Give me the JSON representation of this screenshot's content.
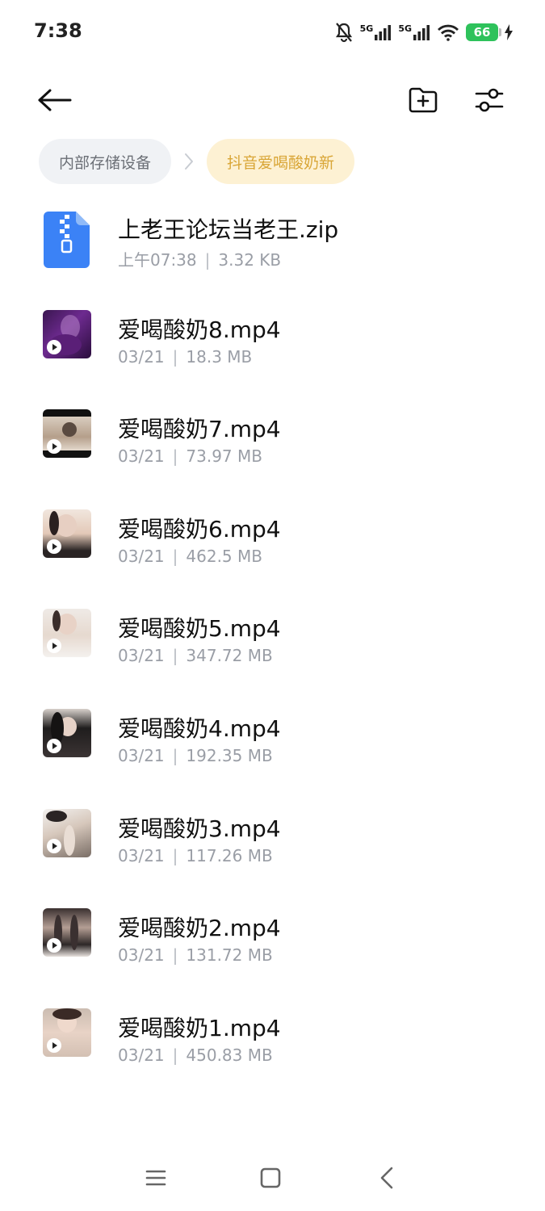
{
  "status_bar": {
    "time": "7:38",
    "network_1": "5G",
    "network_2": "5G",
    "battery": "66"
  },
  "toolbar": {
    "icons": [
      "back-arrow-icon",
      "new-folder-icon",
      "filter-sliders-icon"
    ]
  },
  "breadcrumb": {
    "root": "内部存储设备",
    "current": "抖音爱喝酸奶新"
  },
  "files": [
    {
      "name": "上老王论坛当老王.zip",
      "date": "上午07:38",
      "size": "3.32 KB",
      "type": "zip"
    },
    {
      "name": "爱喝酸奶8.mp4",
      "date": "03/21",
      "size": "18.3 MB",
      "type": "video"
    },
    {
      "name": "爱喝酸奶7.mp4",
      "date": "03/21",
      "size": "73.97 MB",
      "type": "video"
    },
    {
      "name": "爱喝酸奶6.mp4",
      "date": "03/21",
      "size": "462.5 MB",
      "type": "video"
    },
    {
      "name": "爱喝酸奶5.mp4",
      "date": "03/21",
      "size": "347.72 MB",
      "type": "video"
    },
    {
      "name": "爱喝酸奶4.mp4",
      "date": "03/21",
      "size": "192.35 MB",
      "type": "video"
    },
    {
      "name": "爱喝酸奶3.mp4",
      "date": "03/21",
      "size": "117.26 MB",
      "type": "video"
    },
    {
      "name": "爱喝酸奶2.mp4",
      "date": "03/21",
      "size": "131.72 MB",
      "type": "video"
    },
    {
      "name": "爱喝酸奶1.mp4",
      "date": "03/21",
      "size": "450.83 MB",
      "type": "video"
    }
  ],
  "meta_separator": "|",
  "colors": {
    "accent": "#d9a637",
    "accent_bg": "#fdf1d3",
    "zip_blue": "#3b82f6",
    "battery_green": "#2ec25b"
  }
}
